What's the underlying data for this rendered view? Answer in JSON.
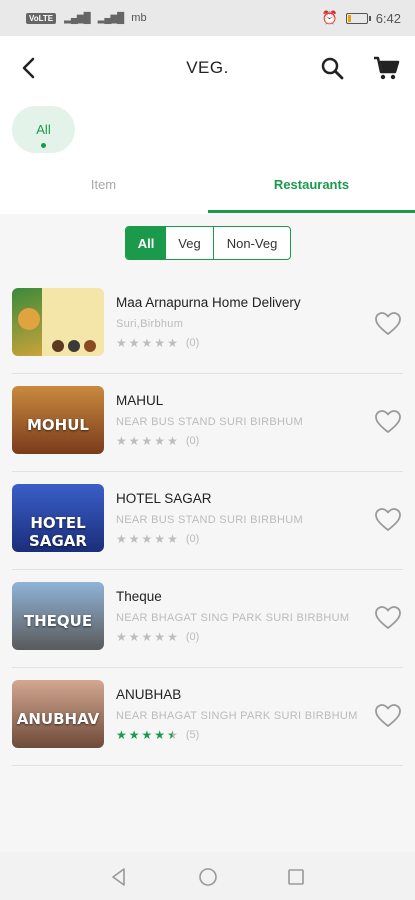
{
  "status_bar": {
    "network": "mb",
    "sim_chip": "VoLTE",
    "time": "6:42",
    "battery_level": 0.2
  },
  "header": {
    "title": "VEG."
  },
  "chips": [
    {
      "label": "All",
      "selected": true
    }
  ],
  "tabs": [
    {
      "label": "Item",
      "active": false
    },
    {
      "label": "Restaurants",
      "active": true
    }
  ],
  "filter": [
    {
      "label": "All",
      "selected": true
    },
    {
      "label": "Veg",
      "selected": false
    },
    {
      "label": "Non-Veg",
      "selected": false
    }
  ],
  "restaurants": [
    {
      "name": "Maa Arnapurna Home Delivery",
      "address": "Suri,Birbhum",
      "rating": 0,
      "rating_count": "(0)",
      "thumb_label": "",
      "thumb_colors": [
        "#e8c24a",
        "#3a8a3a"
      ]
    },
    {
      "name": "MAHUL",
      "address": "NEAR BUS STAND SURI BIRBHUM",
      "rating": 0,
      "rating_count": "(0)",
      "thumb_label": "MOHUL",
      "thumb_colors": [
        "#c98a3e",
        "#7a3b1c"
      ]
    },
    {
      "name": "HOTEL SAGAR",
      "address": "NEAR BUS STAND SURI BIRBHUM",
      "rating": 0,
      "rating_count": "(0)",
      "thumb_label": "HOTEL SAGAR",
      "thumb_colors": [
        "#3a5fc8",
        "#1b2e7a"
      ]
    },
    {
      "name": "Theque",
      "address": "NEAR BHAGAT SING PARK SURI BIRBHUM",
      "rating": 0,
      "rating_count": "(0)",
      "thumb_label": "THEQUE",
      "thumb_colors": [
        "#8fb4d8",
        "#5a5a5a"
      ]
    },
    {
      "name": "ANUBHAB",
      "address": "NEAR BHAGAT SINGH PARK SURI BIRBHUM",
      "rating": 4.5,
      "rating_count": "(5)",
      "thumb_label": "ANUBHAV",
      "thumb_colors": [
        "#d4a890",
        "#6e4a3a"
      ]
    }
  ],
  "colors": {
    "accent": "#1b9a4b",
    "star_empty": "#bdbdbd",
    "star_filled": "#1b9a4b"
  }
}
